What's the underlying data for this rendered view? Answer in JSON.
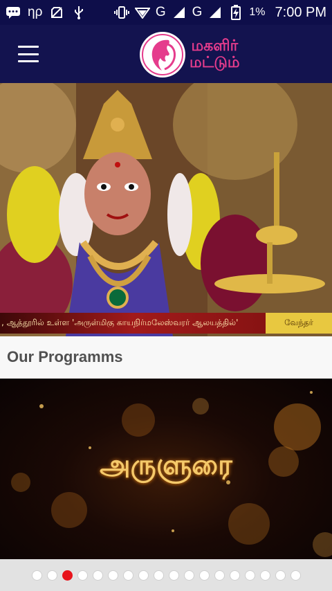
{
  "status_bar": {
    "carrier_glyph": "ηρ",
    "network_1": "G",
    "network_2": "G",
    "battery_percent": "1%",
    "time": "7:00 PM",
    "icons": [
      "message-icon",
      "carrier-icon",
      "no-sim-icon",
      "usb-icon",
      "vibrate-icon",
      "wifi-icon",
      "signal-icon",
      "signal-icon",
      "battery-charging-icon"
    ]
  },
  "app_bar": {
    "logo_line1": "மகளிர்",
    "logo_line2": "மட்டும்",
    "menu_icon": "hamburger-menu-icon",
    "background": "#13134f",
    "logo_color": "#e53c8c"
  },
  "hero": {
    "ticker_text": ", ஆத்தூரில் உள்ள 'அருள்மிகு காயநிர்மலேஸ்வரர் ஆலயத்தில்'",
    "ticker_tag": "வேந்தர்"
  },
  "section": {
    "title": "Our Programms"
  },
  "program": {
    "title": "அருளுரை"
  },
  "pager": {
    "total": 18,
    "active_index": 2,
    "active_color": "#e8141c"
  }
}
